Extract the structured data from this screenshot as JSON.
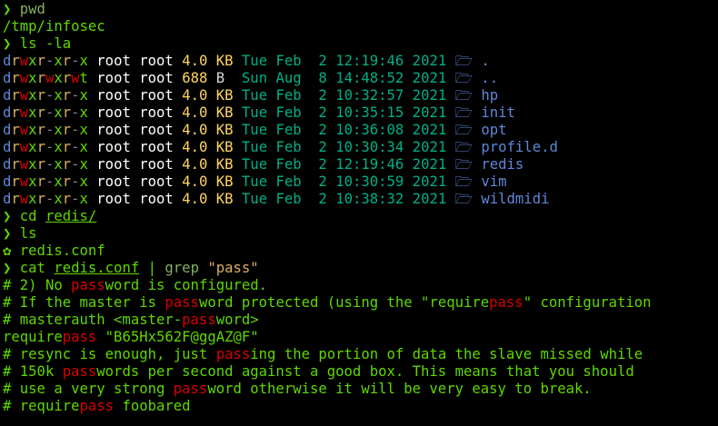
{
  "terminal": {
    "colors": {
      "background": "#000000",
      "prompt": "#5fd700",
      "command": "#5fd700",
      "command_dim": "#87af5f",
      "string": "#d7af5f",
      "output": "#5fd700",
      "perm_dir": "#5f87d7",
      "perm_read": "#d7af5f",
      "perm_write": "#d70000",
      "perm_exec": "#5fd700",
      "perm_dash": "#808080",
      "owner": "#ffffff",
      "size": "#ffd75f",
      "unit": "#d7d7d7",
      "date": "#00af87",
      "dir_name": "#5f87d7",
      "match": "#d70000"
    },
    "lines": [
      [
        {
          "t": "❯ ",
          "c": "prompt"
        },
        {
          "t": "pwd",
          "c": "command_dim"
        }
      ],
      [
        {
          "t": "/tmp/infosec",
          "c": "output"
        }
      ],
      [
        {
          "t": "❯ ",
          "c": "prompt"
        },
        {
          "t": "ls -la",
          "c": "command"
        }
      ],
      [
        {
          "t": "d",
          "c": "perm_dir"
        },
        {
          "t": "r",
          "c": "perm_read"
        },
        {
          "t": "w",
          "c": "perm_write"
        },
        {
          "t": "x",
          "c": "perm_exec"
        },
        {
          "t": "r",
          "c": "perm_read"
        },
        {
          "t": "-",
          "c": "perm_dash"
        },
        {
          "t": "x",
          "c": "perm_exec"
        },
        {
          "t": "r",
          "c": "perm_read"
        },
        {
          "t": "-",
          "c": "perm_dash"
        },
        {
          "t": "x",
          "c": "perm_exec"
        },
        {
          "t": " root root ",
          "c": "owner"
        },
        {
          "t": "4.0",
          "c": "size"
        },
        {
          "t": " ",
          "c": "owner"
        },
        {
          "t": "KB",
          "c": "size"
        },
        {
          "t": " Tue Feb  2 12:19:46 2021 ",
          "c": "date"
        },
        {
          "t": "🗁 .",
          "c": "dir_name"
        }
      ],
      [
        {
          "t": "d",
          "c": "perm_dir"
        },
        {
          "t": "r",
          "c": "perm_read"
        },
        {
          "t": "w",
          "c": "perm_write"
        },
        {
          "t": "x",
          "c": "perm_exec"
        },
        {
          "t": "r",
          "c": "perm_read"
        },
        {
          "t": "w",
          "c": "perm_write"
        },
        {
          "t": "x",
          "c": "perm_exec"
        },
        {
          "t": "r",
          "c": "perm_read"
        },
        {
          "t": "w",
          "c": "perm_write"
        },
        {
          "t": "t",
          "c": "perm_exec"
        },
        {
          "t": " root root ",
          "c": "owner"
        },
        {
          "t": "688",
          "c": "size"
        },
        {
          "t": " ",
          "c": "owner"
        },
        {
          "t": "B",
          "c": "unit"
        },
        {
          "t": "  Sun Aug  8 14:48:52 2021 ",
          "c": "date"
        },
        {
          "t": "🗁 ..",
          "c": "dir_name"
        }
      ],
      [
        {
          "t": "d",
          "c": "perm_dir"
        },
        {
          "t": "r",
          "c": "perm_read"
        },
        {
          "t": "w",
          "c": "perm_write"
        },
        {
          "t": "x",
          "c": "perm_exec"
        },
        {
          "t": "r",
          "c": "perm_read"
        },
        {
          "t": "-",
          "c": "perm_dash"
        },
        {
          "t": "x",
          "c": "perm_exec"
        },
        {
          "t": "r",
          "c": "perm_read"
        },
        {
          "t": "-",
          "c": "perm_dash"
        },
        {
          "t": "x",
          "c": "perm_exec"
        },
        {
          "t": " root root ",
          "c": "owner"
        },
        {
          "t": "4.0",
          "c": "size"
        },
        {
          "t": " ",
          "c": "owner"
        },
        {
          "t": "KB",
          "c": "size"
        },
        {
          "t": " Tue Feb  2 10:32:57 2021 ",
          "c": "date"
        },
        {
          "t": "🗁 hp",
          "c": "dir_name"
        }
      ],
      [
        {
          "t": "d",
          "c": "perm_dir"
        },
        {
          "t": "r",
          "c": "perm_read"
        },
        {
          "t": "w",
          "c": "perm_write"
        },
        {
          "t": "x",
          "c": "perm_exec"
        },
        {
          "t": "r",
          "c": "perm_read"
        },
        {
          "t": "-",
          "c": "perm_dash"
        },
        {
          "t": "x",
          "c": "perm_exec"
        },
        {
          "t": "r",
          "c": "perm_read"
        },
        {
          "t": "-",
          "c": "perm_dash"
        },
        {
          "t": "x",
          "c": "perm_exec"
        },
        {
          "t": " root root ",
          "c": "owner"
        },
        {
          "t": "4.0",
          "c": "size"
        },
        {
          "t": " ",
          "c": "owner"
        },
        {
          "t": "KB",
          "c": "size"
        },
        {
          "t": " Tue Feb  2 10:35:15 2021 ",
          "c": "date"
        },
        {
          "t": "🗁 init",
          "c": "dir_name"
        }
      ],
      [
        {
          "t": "d",
          "c": "perm_dir"
        },
        {
          "t": "r",
          "c": "perm_read"
        },
        {
          "t": "w",
          "c": "perm_write"
        },
        {
          "t": "x",
          "c": "perm_exec"
        },
        {
          "t": "r",
          "c": "perm_read"
        },
        {
          "t": "-",
          "c": "perm_dash"
        },
        {
          "t": "x",
          "c": "perm_exec"
        },
        {
          "t": "r",
          "c": "perm_read"
        },
        {
          "t": "-",
          "c": "perm_dash"
        },
        {
          "t": "x",
          "c": "perm_exec"
        },
        {
          "t": " root root ",
          "c": "owner"
        },
        {
          "t": "4.0",
          "c": "size"
        },
        {
          "t": " ",
          "c": "owner"
        },
        {
          "t": "KB",
          "c": "size"
        },
        {
          "t": " Tue Feb  2 10:36:08 2021 ",
          "c": "date"
        },
        {
          "t": "🗁 opt",
          "c": "dir_name"
        }
      ],
      [
        {
          "t": "d",
          "c": "perm_dir"
        },
        {
          "t": "r",
          "c": "perm_read"
        },
        {
          "t": "w",
          "c": "perm_write"
        },
        {
          "t": "x",
          "c": "perm_exec"
        },
        {
          "t": "r",
          "c": "perm_read"
        },
        {
          "t": "-",
          "c": "perm_dash"
        },
        {
          "t": "x",
          "c": "perm_exec"
        },
        {
          "t": "r",
          "c": "perm_read"
        },
        {
          "t": "-",
          "c": "perm_dash"
        },
        {
          "t": "x",
          "c": "perm_exec"
        },
        {
          "t": " root root ",
          "c": "owner"
        },
        {
          "t": "4.0",
          "c": "size"
        },
        {
          "t": " ",
          "c": "owner"
        },
        {
          "t": "KB",
          "c": "size"
        },
        {
          "t": " Tue Feb  2 10:30:34 2021 ",
          "c": "date"
        },
        {
          "t": "🗁 profile.d",
          "c": "dir_name"
        }
      ],
      [
        {
          "t": "d",
          "c": "perm_dir"
        },
        {
          "t": "r",
          "c": "perm_read"
        },
        {
          "t": "w",
          "c": "perm_write"
        },
        {
          "t": "x",
          "c": "perm_exec"
        },
        {
          "t": "r",
          "c": "perm_read"
        },
        {
          "t": "-",
          "c": "perm_dash"
        },
        {
          "t": "x",
          "c": "perm_exec"
        },
        {
          "t": "r",
          "c": "perm_read"
        },
        {
          "t": "-",
          "c": "perm_dash"
        },
        {
          "t": "x",
          "c": "perm_exec"
        },
        {
          "t": " root root ",
          "c": "owner"
        },
        {
          "t": "4.0",
          "c": "size"
        },
        {
          "t": " ",
          "c": "owner"
        },
        {
          "t": "KB",
          "c": "size"
        },
        {
          "t": " Tue Feb  2 12:19:46 2021 ",
          "c": "date"
        },
        {
          "t": "🗁 redis",
          "c": "dir_name"
        }
      ],
      [
        {
          "t": "d",
          "c": "perm_dir"
        },
        {
          "t": "r",
          "c": "perm_read"
        },
        {
          "t": "w",
          "c": "perm_write"
        },
        {
          "t": "x",
          "c": "perm_exec"
        },
        {
          "t": "r",
          "c": "perm_read"
        },
        {
          "t": "-",
          "c": "perm_dash"
        },
        {
          "t": "x",
          "c": "perm_exec"
        },
        {
          "t": "r",
          "c": "perm_read"
        },
        {
          "t": "-",
          "c": "perm_dash"
        },
        {
          "t": "x",
          "c": "perm_exec"
        },
        {
          "t": " root root ",
          "c": "owner"
        },
        {
          "t": "4.0",
          "c": "size"
        },
        {
          "t": " ",
          "c": "owner"
        },
        {
          "t": "KB",
          "c": "size"
        },
        {
          "t": " Tue Feb  2 10:30:59 2021 ",
          "c": "date"
        },
        {
          "t": "🗁 vim",
          "c": "dir_name"
        }
      ],
      [
        {
          "t": "d",
          "c": "perm_dir"
        },
        {
          "t": "r",
          "c": "perm_read"
        },
        {
          "t": "w",
          "c": "perm_write"
        },
        {
          "t": "x",
          "c": "perm_exec"
        },
        {
          "t": "r",
          "c": "perm_read"
        },
        {
          "t": "-",
          "c": "perm_dash"
        },
        {
          "t": "x",
          "c": "perm_exec"
        },
        {
          "t": "r",
          "c": "perm_read"
        },
        {
          "t": "-",
          "c": "perm_dash"
        },
        {
          "t": "x",
          "c": "perm_exec"
        },
        {
          "t": " root root ",
          "c": "owner"
        },
        {
          "t": "4.0",
          "c": "size"
        },
        {
          "t": " ",
          "c": "owner"
        },
        {
          "t": "KB",
          "c": "size"
        },
        {
          "t": " Tue Feb  2 10:38:32 2021 ",
          "c": "date"
        },
        {
          "t": "🗁 wildmidi",
          "c": "dir_name"
        }
      ],
      [
        {
          "t": "❯ ",
          "c": "prompt"
        },
        {
          "t": "cd ",
          "c": "command"
        },
        {
          "t": "redis/",
          "c": "command",
          "u": true
        }
      ],
      [
        {
          "t": "❯ ",
          "c": "prompt"
        },
        {
          "t": "ls",
          "c": "command"
        }
      ],
      [
        {
          "t": "✿ ",
          "c": "prompt"
        },
        {
          "t": "redis.conf",
          "c": "output"
        }
      ],
      [
        {
          "t": "❯ ",
          "c": "prompt"
        },
        {
          "t": "cat ",
          "c": "command"
        },
        {
          "t": "redis.conf",
          "c": "command",
          "u": true
        },
        {
          "t": " | ",
          "c": "command"
        },
        {
          "t": "grep",
          "c": "command_dim"
        },
        {
          "t": " ",
          "c": "command"
        },
        {
          "t": "\"pass\"",
          "c": "string"
        }
      ],
      [
        {
          "t": "# 2) No ",
          "c": "output"
        },
        {
          "t": "pass",
          "c": "match"
        },
        {
          "t": "word is configured.",
          "c": "output"
        }
      ],
      [
        {
          "t": "# If the master is ",
          "c": "output"
        },
        {
          "t": "pass",
          "c": "match"
        },
        {
          "t": "word protected (using the \"require",
          "c": "output"
        },
        {
          "t": "pass",
          "c": "match"
        },
        {
          "t": "\" configuration",
          "c": "output"
        }
      ],
      [
        {
          "t": "# masterauth <master-",
          "c": "output"
        },
        {
          "t": "pass",
          "c": "match"
        },
        {
          "t": "word>",
          "c": "output"
        }
      ],
      [
        {
          "t": "require",
          "c": "output"
        },
        {
          "t": "pass",
          "c": "match"
        },
        {
          "t": " \"B65Hx562F@ggAZ@F\"",
          "c": "output"
        }
      ],
      [
        {
          "t": "# resync is enough, just ",
          "c": "output"
        },
        {
          "t": "pass",
          "c": "match"
        },
        {
          "t": "ing the portion of data the slave missed while",
          "c": "output"
        }
      ],
      [
        {
          "t": "# 150k ",
          "c": "output"
        },
        {
          "t": "pass",
          "c": "match"
        },
        {
          "t": "words per second against a good box. This means that you should",
          "c": "output"
        }
      ],
      [
        {
          "t": "# use a very strong ",
          "c": "output"
        },
        {
          "t": "pass",
          "c": "match"
        },
        {
          "t": "word otherwise it will be very easy to break.",
          "c": "output"
        }
      ],
      [
        {
          "t": "# require",
          "c": "output"
        },
        {
          "t": "pass",
          "c": "match"
        },
        {
          "t": " foobared",
          "c": "output"
        }
      ]
    ]
  }
}
